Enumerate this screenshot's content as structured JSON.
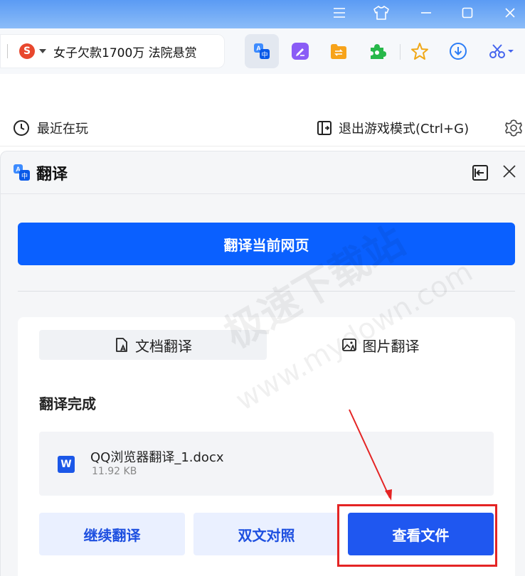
{
  "toolbar": {
    "address_text": "女子欠款1700万 法院悬赏"
  },
  "gamebar": {
    "recent_label": "最近在玩",
    "exit_label": "退出游戏模式(Ctrl+G)"
  },
  "panel": {
    "title": "翻译",
    "translate_page_button": "翻译当前网页",
    "tabs": {
      "document": "文档翻译",
      "image": "图片翻译"
    },
    "status_title": "翻译完成",
    "file": {
      "icon_letter": "W",
      "name": "QQ浏览器翻译_1.docx",
      "size": "11.92 KB"
    },
    "actions": {
      "continue": "继续翻译",
      "bilingual": "双文对照",
      "view": "查看文件"
    }
  },
  "watermark": {
    "line1": "极速下载站",
    "line2": "www.mydown.com"
  },
  "colors": {
    "primary": "#0a60ff",
    "highlight": "#e42424"
  }
}
